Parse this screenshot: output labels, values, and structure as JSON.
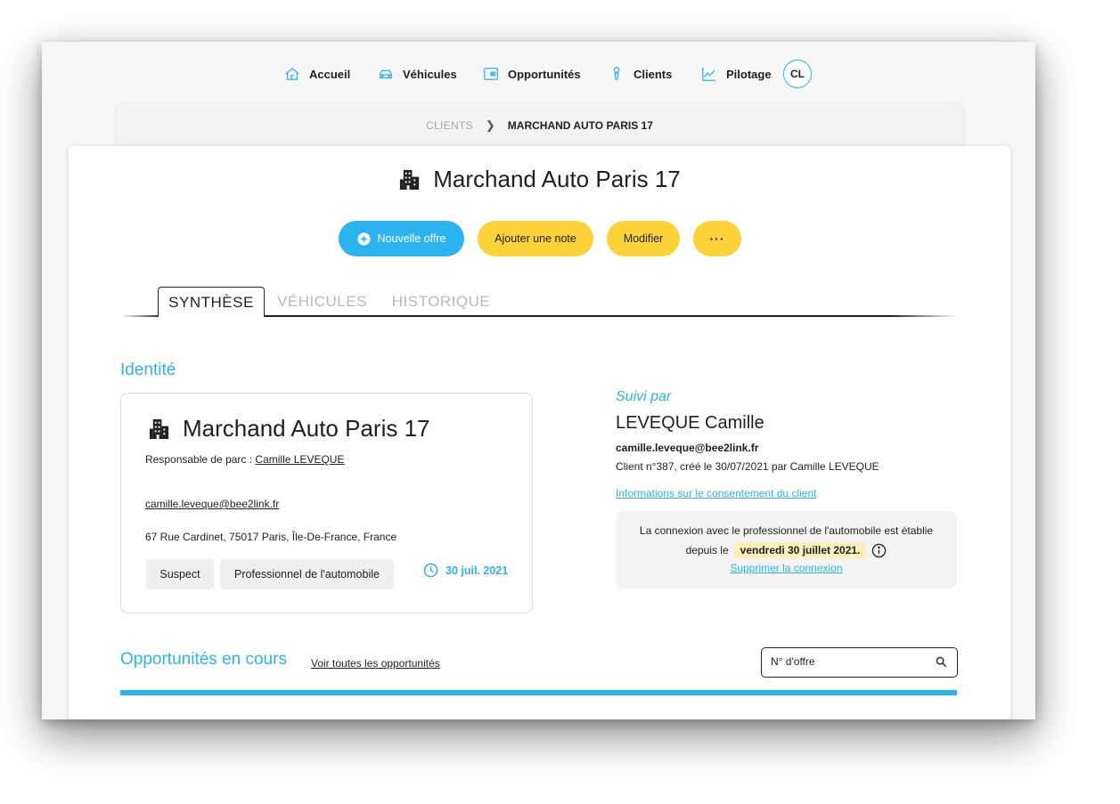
{
  "nav": {
    "items": [
      {
        "label": "Accueil",
        "icon": "home-icon"
      },
      {
        "label": "Véhicules",
        "icon": "car-icon"
      },
      {
        "label": "Opportunités",
        "icon": "wallet-icon"
      },
      {
        "label": "Clients",
        "icon": "user-pin-icon"
      },
      {
        "label": "Pilotage",
        "icon": "chart-line-icon"
      }
    ],
    "avatar": "CL"
  },
  "breadcrumb": {
    "parent": "CLIENTS",
    "current": "MARCHAND AUTO PARIS 17"
  },
  "header": {
    "title": "Marchand Auto Paris 17",
    "icon": "building-icon"
  },
  "actions": {
    "new_offer": "Nouvelle offre",
    "add_note": "Ajouter une note",
    "edit": "Modifier",
    "more": "···"
  },
  "tabs": [
    {
      "label": "SYNTHÈSE",
      "active": true
    },
    {
      "label": "VÉHICULES",
      "active": false
    },
    {
      "label": "HISTORIQUE",
      "active": false
    }
  ],
  "identity": {
    "section_title": "Identité",
    "name": "Marchand Auto Paris 17",
    "manager_label": "Responsable de parc : ",
    "manager_name": "Camille LEVEQUE",
    "email": "camille.leveque@bee2link.fr",
    "address": "67 Rue Cardinet, 75017 Paris, Île-De-France, France",
    "tags": [
      "Suspect",
      "Professionnel de l'automobile"
    ],
    "date": "30 juil. 2021"
  },
  "followed": {
    "label": "Suivi par",
    "name": "LEVEQUE Camille",
    "email": "camille.leveque@bee2link.fr",
    "client_info": "Client n°387, créé le 30/07/2021 par Camille LEVEQUE",
    "consent_link": "Informations sur le consentement du client",
    "connection_line1": "La connexion avec le professionnel de l'automobile est établie",
    "connection_prefix": "depuis le",
    "connection_date": "vendredi 30 juillet 2021.",
    "remove_link": "Supprimer la connexion"
  },
  "opportunities": {
    "title": "Opportunités en cours",
    "see_all": "Voir toutes les opportunités",
    "search_placeholder": "N° d'offre"
  },
  "colors": {
    "accent": "#2bb3ef",
    "yellow": "#fcd239",
    "highlight": "#fbf0b9"
  }
}
